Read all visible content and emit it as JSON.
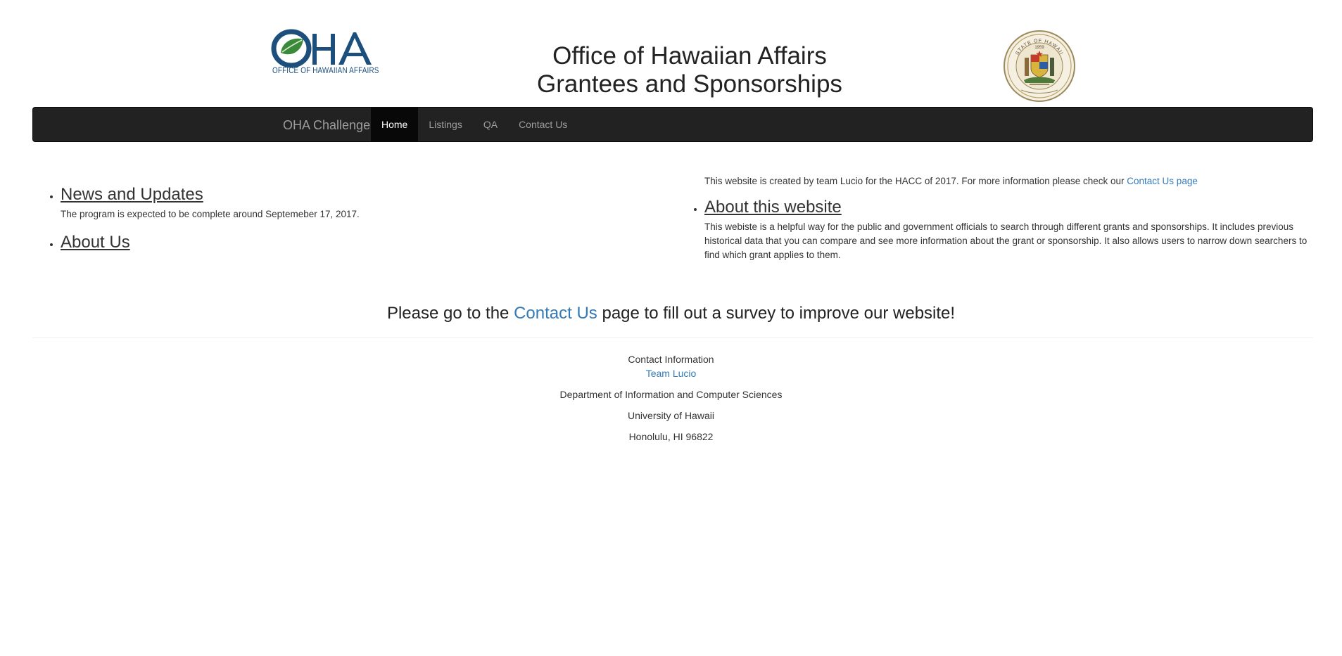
{
  "header": {
    "logo_caption": "OFFICE OF HAWAIIAN AFFAIRS",
    "title_line1": "Office of Hawaiian Affairs",
    "title_line2": "Grantees and Sponsorships",
    "seal_text": "STATE OF HAWAII",
    "seal_year": "1959"
  },
  "navbar": {
    "brand": "OHA Challenge",
    "items": [
      {
        "label": "Home",
        "active": true
      },
      {
        "label": "Listings",
        "active": false
      },
      {
        "label": "QA",
        "active": false
      },
      {
        "label": "Contact Us",
        "active": false
      }
    ]
  },
  "left_column": {
    "news_heading": "News and Updates",
    "news_text": "The program is expected to be complete around Septemeber 17, 2017.",
    "about_us_heading": "About Us"
  },
  "right_column": {
    "intro_text": "This website is created by team Lucio for the HACC of 2017. For more information please check our ",
    "intro_link": "Contact Us page",
    "about_heading": "About this website",
    "about_text": "This webiste is a helpful way for the public and government officials to search through different grants and sponsorships. It includes previous historical data that you can compare and see more information about the grant or sponsorship. It also allows users to narrow down searchers to find which grant applies to them."
  },
  "survey": {
    "before": "Please go to the ",
    "link": "Contact Us",
    "after": " page to fill out a survey to improve our website!"
  },
  "footer": {
    "contact_label": "Contact Information",
    "team_link": "Team Lucio",
    "department": "Department of Information and Computer Sciences",
    "university": "University of Hawaii",
    "address": "Honolulu, HI 96822"
  },
  "colors": {
    "navbar_bg": "#222222",
    "navbar_active": "#080808",
    "link": "#337ab7",
    "logo_blue": "#1d4f7c",
    "logo_green": "#3a8a3a"
  }
}
